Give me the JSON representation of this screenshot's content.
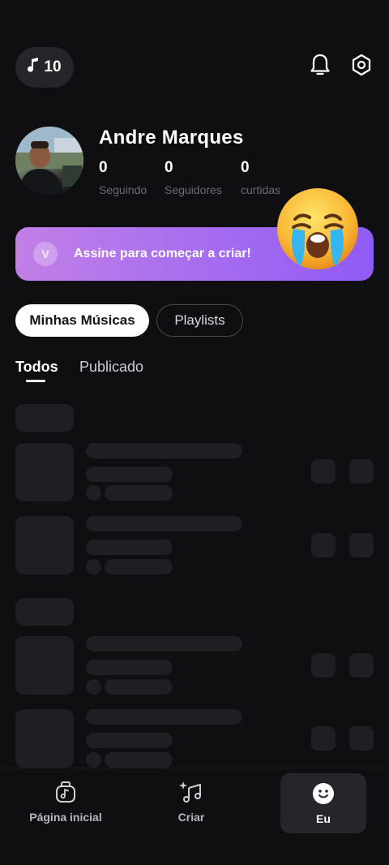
{
  "header": {
    "credits_count": "10",
    "icons": [
      "music-note-icon",
      "bell-icon",
      "settings-hex-icon"
    ]
  },
  "profile": {
    "name": "Andre Marques",
    "stats": [
      {
        "value": "0",
        "label": "Seguindo"
      },
      {
        "value": "0",
        "label": "Seguidores"
      },
      {
        "value": "0",
        "label": "curtidas"
      }
    ]
  },
  "banner": {
    "badge": "V",
    "text": "Assine para começar a criar!",
    "sticker": "crying-face-emoji"
  },
  "tabs": {
    "primary": [
      "Minhas Músicas",
      "Playlists"
    ],
    "secondary": [
      "Todos",
      "Publicado"
    ]
  },
  "bottom_nav": {
    "items": [
      {
        "label": "Página inicial",
        "icon": "music-box-icon"
      },
      {
        "label": "Criar",
        "icon": "sparkle-music-icon"
      },
      {
        "label": "Eu",
        "icon": "smiley-profile-icon"
      }
    ],
    "active": "Eu"
  },
  "colors": {
    "background": "#0f0e11",
    "banner_start": "#c17fe6",
    "banner_end": "#8f5bf5",
    "skeleton": "#1f1e22"
  }
}
